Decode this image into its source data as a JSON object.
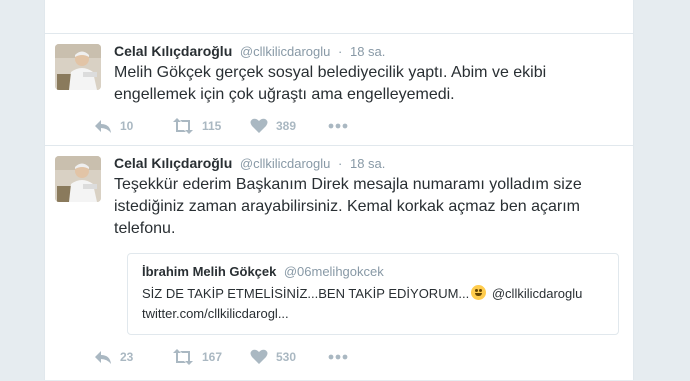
{
  "tweets": [
    {
      "author": {
        "name": "Celal Kılıçdaroğlu",
        "handle": "@cllkilicdaroglu"
      },
      "separator": "·",
      "time": "18 sa.",
      "text": "Melih Gökçek gerçek sosyal belediyecilik yaptı. Abim ve ekibi engellemek için çok uğraştı ama engelleyemedi.",
      "stats": {
        "replies": "10",
        "retweets": "115",
        "likes": "389"
      }
    },
    {
      "author": {
        "name": "Celal Kılıçdaroğlu",
        "handle": "@cllkilicdaroglu"
      },
      "separator": "·",
      "time": "18 sa.",
      "text": "Teşekkür ederim Başkanım Direk mesajla numaramı yolladım size istediğiniz zaman arayabilirsiniz. Kemal korkak açmaz ben açarım telefonu.",
      "quoted": {
        "name": "İbrahim Melih Gökçek",
        "handle": "@06melihgokcek",
        "text_before_emoji": "SİZ DE TAKİP ETMELİSİNİZ...BEN TAKİP EDİYORUM...",
        "emoji": "grinning-face-emoji",
        "text_after_emoji": " @cllkilicdaroglu twitter.com/cllkilicdarogl..."
      },
      "stats": {
        "replies": "23",
        "retweets": "167",
        "likes": "530"
      }
    }
  ],
  "icons": {
    "reply": "reply-icon",
    "retweet": "retweet-icon",
    "like": "heart-icon",
    "more": "more-dots-icon"
  },
  "colors": {
    "background": "#e6ecf0",
    "card": "#ffffff",
    "border": "#e1e8ed",
    "text": "#292f33",
    "muted": "#8899a6",
    "action_icon": "#aab8c2"
  }
}
